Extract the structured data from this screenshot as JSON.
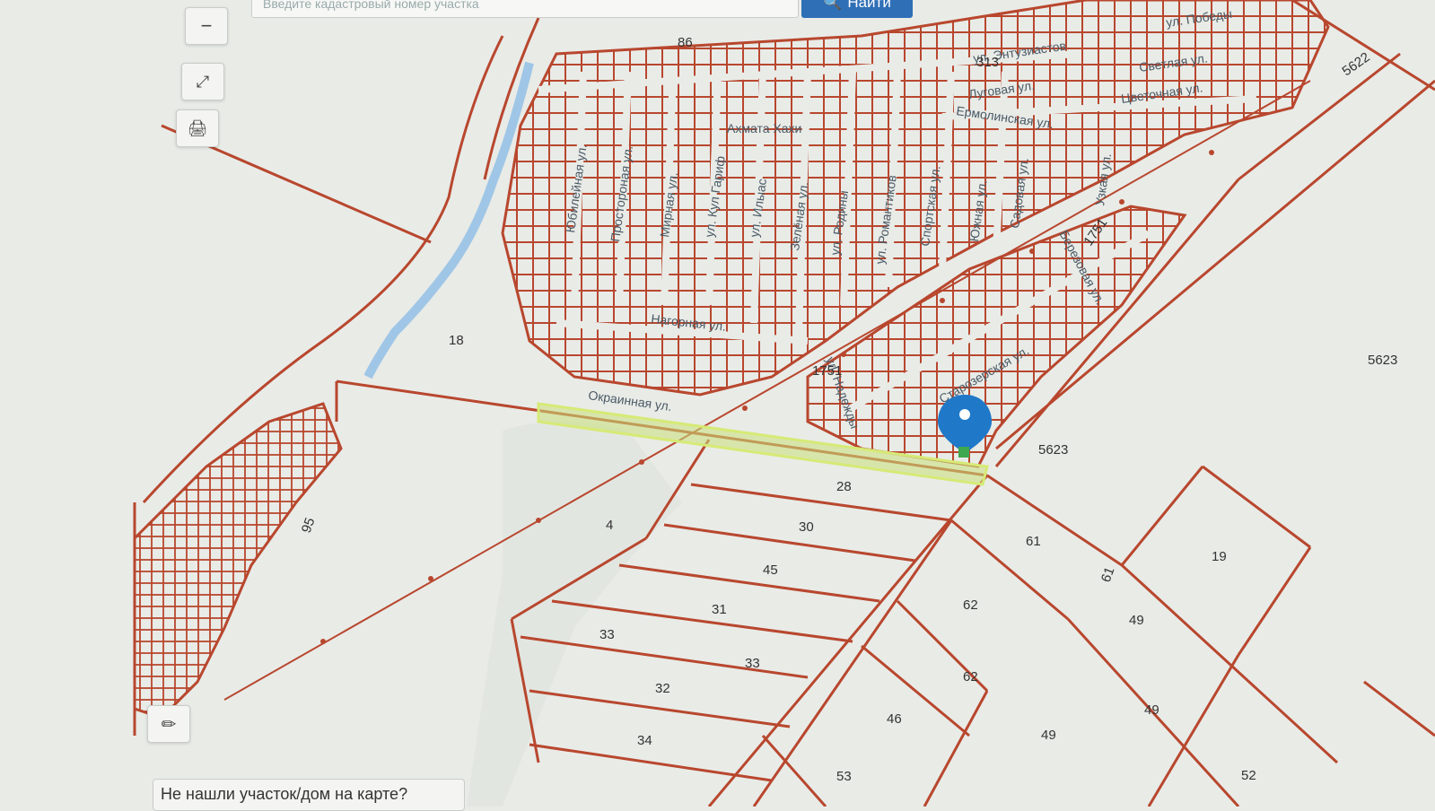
{
  "search": {
    "placeholder": "Введите кадастровый номер участка",
    "button_label": "Найти"
  },
  "controls": {
    "zoom_out": "−"
  },
  "help_link": "Не нашли участок/дом на карте?",
  "colors": {
    "parcel_line": "#b8472e",
    "selected": "#c8e07a",
    "marker": "#1f78c8",
    "button": "#2f6fb6"
  },
  "streets": [
    "ул. Победы",
    "ул. Энтузиастов",
    "Луговая ул.",
    "Светлая ул.",
    "Цветочная ул.",
    "Ермолинская ул.",
    "Ахмата Хахи",
    "Юбилейная ул.",
    "Простороная ул.",
    "Мирная ул.",
    "ул. Кул Гариф",
    "ул. Илыас",
    "Зелёная ул.",
    "ул. Родины",
    "ул. Романтиков",
    "Спортская ул.",
    "Южная ул.",
    "Садовая ул.",
    "Узкая ул.",
    "Березовая ул.",
    "Нагорная ул.",
    "Окраинная ул.",
    "ул. Надежды",
    "Старозерская ул."
  ],
  "parcels": [
    "86",
    "313",
    "18",
    "1751",
    "1751",
    "95",
    "4",
    "28",
    "30",
    "45",
    "31",
    "33",
    "33",
    "32",
    "34",
    "5623",
    "5623",
    "5622",
    "61",
    "61",
    "19",
    "62",
    "62",
    "49",
    "49",
    "49",
    "46",
    "53",
    "52"
  ]
}
